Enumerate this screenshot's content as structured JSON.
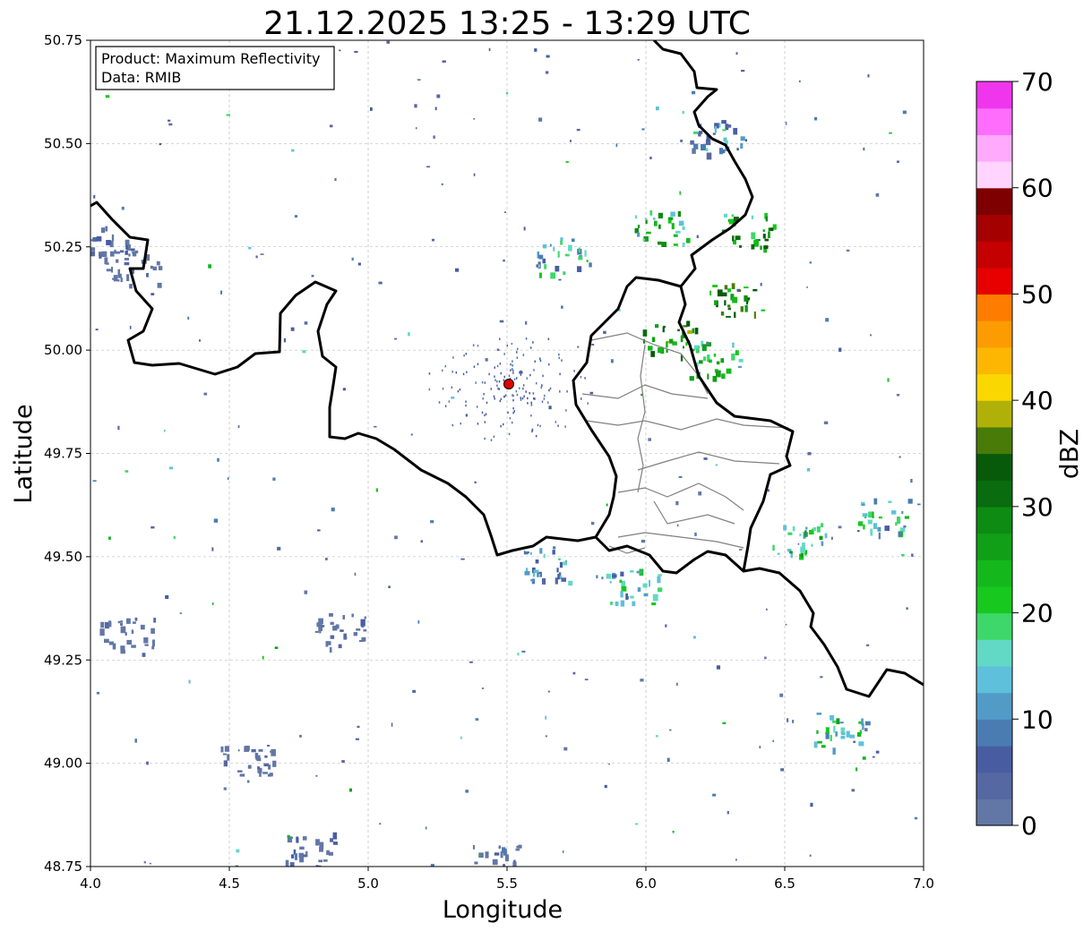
{
  "title": "21.12.2025 13:25 - 13:29 UTC",
  "info_box": {
    "line1": "Product: Maximum Reflectivity",
    "line2": "Data: RMIB"
  },
  "colorbar": {
    "label": "dBZ",
    "ticks": [
      "0",
      "10",
      "20",
      "30",
      "40",
      "50",
      "60",
      "70"
    ],
    "range": [
      0,
      70
    ],
    "colors": [
      "#6277a6",
      "#5568a2",
      "#485da1",
      "#4a7cb2",
      "#529bc6",
      "#5ec0da",
      "#62d9c5",
      "#3ed76a",
      "#17c81f",
      "#14b81c",
      "#129f18",
      "#0d8b13",
      "#096c0e",
      "#075a0a",
      "#487b08",
      "#b0b108",
      "#fbd700",
      "#fdb703",
      "#fd9b03",
      "#fe7c00",
      "#e60000",
      "#c40000",
      "#a50000",
      "#7e0000",
      "#ffd4fe",
      "#ffaafd",
      "#ff6dfd",
      "#ef36ed"
    ]
  },
  "chart_data": {
    "type": "heatmap",
    "product": "Maximum Reflectivity",
    "source": "RMIB",
    "title": "21.12.2025 13:25 - 13:29 UTC",
    "xlabel": "Longitude",
    "ylabel": "Latitude",
    "xlim": [
      4.0,
      7.0
    ],
    "ylim": [
      48.75,
      50.75
    ],
    "xticks": [
      "4.0",
      "4.5",
      "5.0",
      "5.5",
      "6.0",
      "6.5",
      "7.0"
    ],
    "yticks": [
      "48.75",
      "49.00",
      "49.25",
      "49.50",
      "49.75",
      "50.00",
      "50.25",
      "50.50",
      "50.75"
    ],
    "grid": true,
    "colorbar_unit": "dBZ",
    "colorbar_range": [
      0,
      70
    ],
    "radar_site": {
      "lon": 5.505,
      "lat": 49.915
    },
    "echo_clusters": [
      {
        "lon": 4.15,
        "lat": 50.2,
        "dbz": 5
      },
      {
        "lon": 4.05,
        "lat": 50.26,
        "dbz": 8
      },
      {
        "lon": 4.9,
        "lat": 49.32,
        "dbz": 6
      },
      {
        "lon": 4.13,
        "lat": 49.31,
        "dbz": 5
      },
      {
        "lon": 4.78,
        "lat": 48.79,
        "dbz": 8
      },
      {
        "lon": 5.45,
        "lat": 48.76,
        "dbz": 8
      },
      {
        "lon": 4.56,
        "lat": 49.0,
        "dbz": 5
      },
      {
        "lon": 6.37,
        "lat": 50.29,
        "dbz": 35
      },
      {
        "lon": 6.32,
        "lat": 50.12,
        "dbz": 38
      },
      {
        "lon": 6.25,
        "lat": 49.98,
        "dbz": 28
      },
      {
        "lon": 6.08,
        "lat": 50.03,
        "dbz": 40
      },
      {
        "lon": 6.05,
        "lat": 50.3,
        "dbz": 30
      },
      {
        "lon": 5.7,
        "lat": 50.23,
        "dbz": 22
      },
      {
        "lon": 6.85,
        "lat": 49.6,
        "dbz": 25
      },
      {
        "lon": 6.55,
        "lat": 49.55,
        "dbz": 28
      },
      {
        "lon": 5.95,
        "lat": 49.43,
        "dbz": 24
      },
      {
        "lon": 6.7,
        "lat": 49.08,
        "dbz": 26
      },
      {
        "lon": 5.65,
        "lat": 49.48,
        "dbz": 20
      },
      {
        "lon": 6.25,
        "lat": 50.52,
        "dbz": 20
      }
    ]
  }
}
